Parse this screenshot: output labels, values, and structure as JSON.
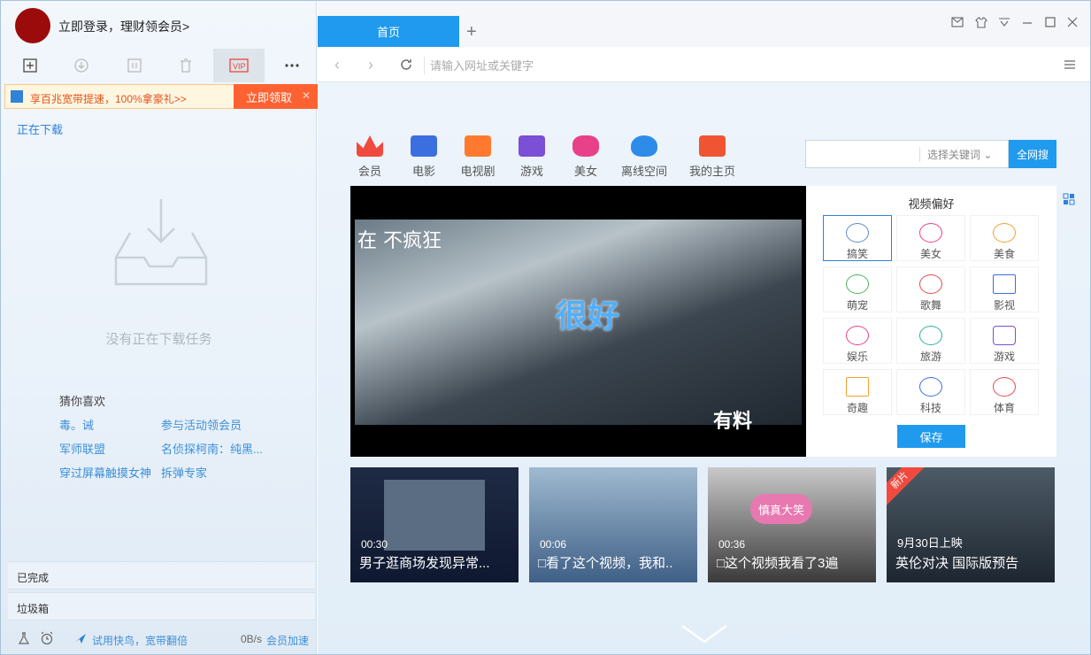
{
  "user": {
    "login_text": "立即登录，理财领会员>"
  },
  "promo": {
    "text": "享百兆宽带提速，100%拿豪礼>>",
    "button": "立即领取"
  },
  "downloads": {
    "section_title": "正在下载",
    "empty_text": "没有正在下载任务",
    "guess_title": "猜你喜欢",
    "guess_items": [
      "毒。诫",
      "参与活动领会员",
      "军师联盟",
      "名侦探柯南：纯黑...",
      "穿过屏幕触摸女神",
      "拆弹专家"
    ],
    "completed": "已完成",
    "trash": "垃圾箱"
  },
  "statusbar": {
    "boost_text": "试用快鸟，宽带翻倍",
    "speed": "0B/s",
    "vip_text": "会员加速"
  },
  "browser": {
    "tab_label": "首页",
    "url_placeholder": "请输入网址或关键字"
  },
  "categories": [
    "会员",
    "电影",
    "电视剧",
    "游戏",
    "美女",
    "离线空间",
    "我的主页"
  ],
  "search": {
    "select_label": "选择关键词",
    "button": "全网搜"
  },
  "video": {
    "caption": "在 不疯狂",
    "overlay_word": "很好",
    "logo": "有料"
  },
  "preferences": {
    "title": "视频偏好",
    "items": [
      "搞笑",
      "美女",
      "美食",
      "萌宠",
      "歌舞",
      "影视",
      "娱乐",
      "旅游",
      "游戏",
      "奇趣",
      "科技",
      "体育"
    ],
    "save": "保存"
  },
  "thumbs": [
    {
      "duration": "00:30",
      "title": "男子逛商场发现异常..."
    },
    {
      "duration": "00:06",
      "title": "□看了这个视频，我和.."
    },
    {
      "duration": "00:36",
      "title": "□这个视频我看了3遍"
    },
    {
      "duration": "9月30日上映",
      "title": "英伦对决 国际版预告",
      "badge": "新片"
    }
  ],
  "thumb_overlay": "慎真大笑",
  "colors": {
    "accent": "#1f9aee",
    "promo": "#ff6232",
    "avatar": "#9b0b0b"
  }
}
